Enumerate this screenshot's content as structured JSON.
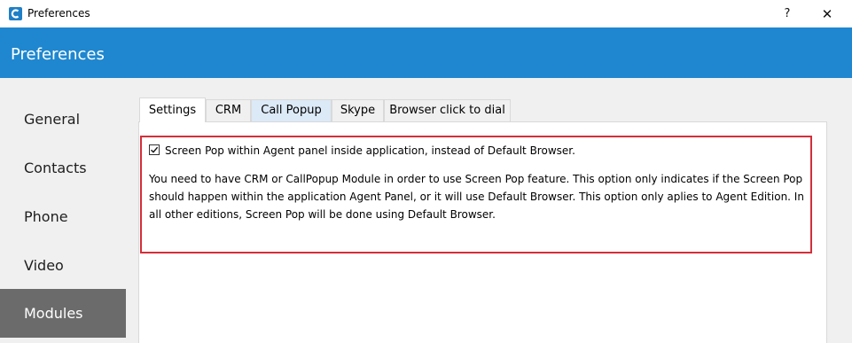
{
  "window": {
    "title": "Preferences",
    "help_label": "?",
    "close_label": "✕",
    "app_icon": "app-logo-icon"
  },
  "header": {
    "title": "Preferences"
  },
  "sidebar": {
    "items": [
      {
        "label": "General",
        "active": false
      },
      {
        "label": "Contacts",
        "active": false
      },
      {
        "label": "Phone",
        "active": false
      },
      {
        "label": "Video",
        "active": false
      },
      {
        "label": "Modules",
        "active": true
      }
    ]
  },
  "tabs": [
    {
      "label": "Settings",
      "active": true
    },
    {
      "label": "CRM"
    },
    {
      "label": "Call Popup",
      "highlighted": true
    },
    {
      "label": "Skype"
    },
    {
      "label": "Browser click to dial"
    }
  ],
  "settings": {
    "screen_pop_checkbox": {
      "label": "Screen Pop within Agent panel inside application, instead of Default Browser.",
      "checked": true
    },
    "description": "You need to have CRM or CallPopup Module in order to use Screen Pop feature. This option only indicates if the Screen Pop should happen within the application Agent Panel, or it will use Default Browser. This option only aplies to Agent Edition. In all other editions, Screen Pop will be done using Default Browser."
  },
  "colors": {
    "header": "#1f87cf",
    "sidebar_active": "#6b6b6b",
    "highlight_border": "#d32f3a",
    "tab_highlight": "#dce9f7"
  }
}
